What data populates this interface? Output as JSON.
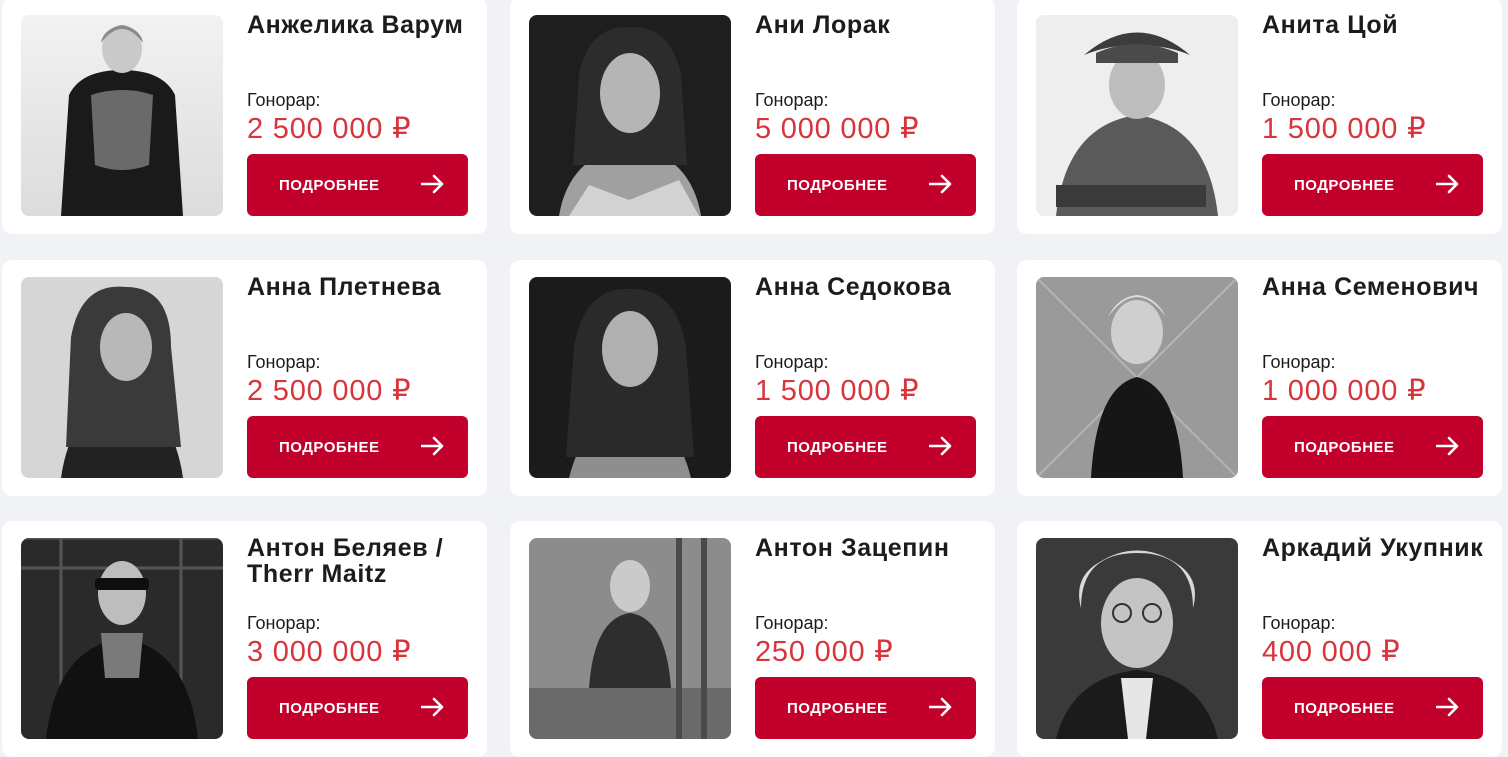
{
  "labels": {
    "fee_label": "Гонорар:",
    "more_button": "ПОДРОБНЕЕ"
  },
  "icons": {
    "button_icon": "arrow-right-icon"
  },
  "colors": {
    "page_background": "#f1f2f5",
    "card_background": "#ffffff",
    "button": "#c1002c",
    "fee_text": "#d7343c",
    "name_text": "#1c1c1c"
  },
  "artists": [
    {
      "name": "Анжелика Варум",
      "fee": "2 500 000 ₽"
    },
    {
      "name": "Ани Лорак",
      "fee": "5 000 000 ₽"
    },
    {
      "name": "Анита Цой",
      "fee": "1 500 000 ₽"
    },
    {
      "name": "Анна Плетнева",
      "fee": "2 500 000 ₽"
    },
    {
      "name": "Анна Седокова",
      "fee": "1 500 000 ₽"
    },
    {
      "name": "Анна Семенович",
      "fee": "1 000 000 ₽"
    },
    {
      "name": "Антон Беляев / Therr Maitz",
      "fee": "3 000 000 ₽"
    },
    {
      "name": "Антон Зацепин",
      "fee": "250 000 ₽"
    },
    {
      "name": "Аркадий Укупник",
      "fee": "400 000 ₽"
    }
  ]
}
